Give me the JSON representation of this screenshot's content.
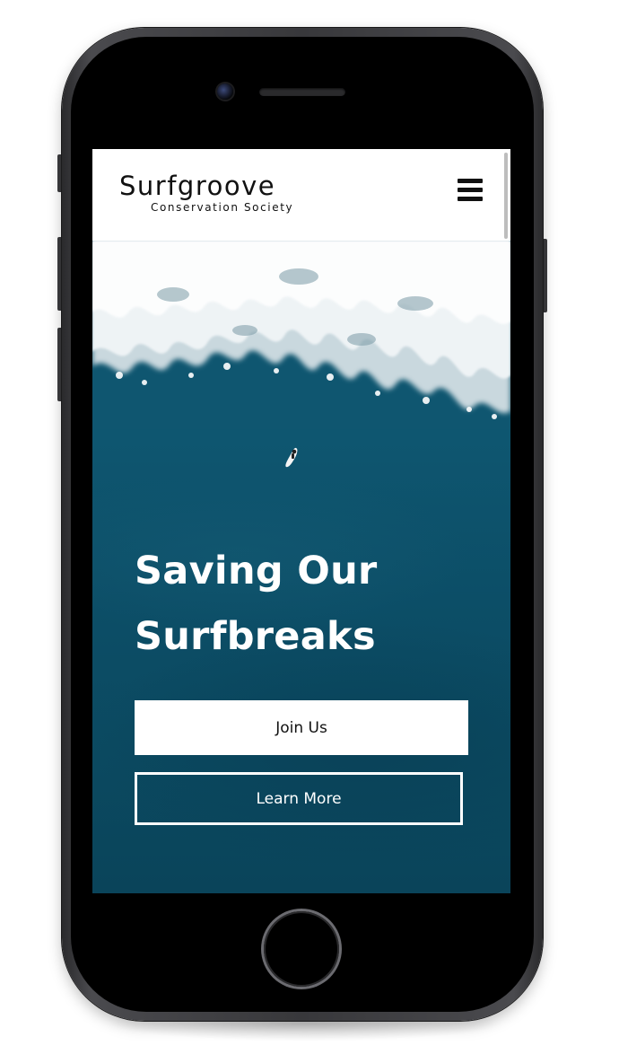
{
  "header": {
    "logo_title": "Surfgroove",
    "logo_subtitle": "Conservation Society",
    "menu_icon": "hamburger-menu-icon"
  },
  "hero": {
    "title": "Saving Our Surfbreaks",
    "background": "aerial ocean wave with surfer",
    "primary_button_label": "Join Us",
    "secondary_button_label": "Learn More"
  },
  "colors": {
    "ocean": "#0c4a63",
    "header_bg": "#ffffff",
    "text_dark": "#111111",
    "text_light": "#ffffff",
    "device_frame": "#38383b"
  }
}
